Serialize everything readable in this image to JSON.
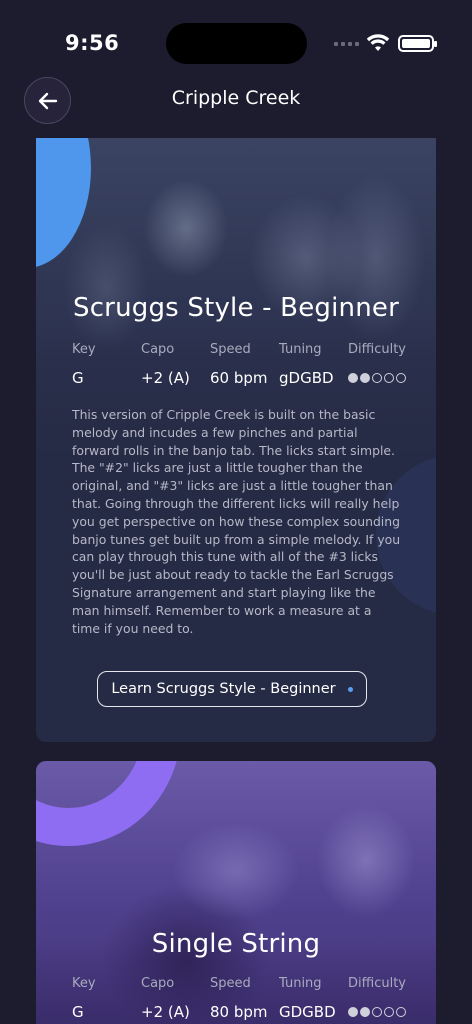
{
  "status_bar": {
    "time": "9:56"
  },
  "nav": {
    "title": "Cripple Creek",
    "back_icon": "arrow-left-icon"
  },
  "meta_labels": {
    "key": "Key",
    "capo": "Capo",
    "speed": "Speed",
    "tuning": "Tuning",
    "difficulty": "Difficulty"
  },
  "arrangements": [
    {
      "title": "Scruggs Style - Beginner",
      "key": "G",
      "capo": "+2 (A)",
      "speed": "60 bpm",
      "tuning": "gDGBD",
      "difficulty": 2,
      "difficulty_max": 5,
      "description": "This version of Cripple Creek is built on the basic melody and incudes a few pinches and partial forward rolls in the banjo tab. The licks start simple. The \"#2\" licks are just a little tougher than the original, and \"#3\" licks are just a little tougher than that. Going through the different licks will really help you get perspective on how these complex sounding banjo tunes get built up from a simple melody. If you can play through this tune with all of the #3 licks you'll be just about ready to tackle the Earl Scruggs Signature arrangement and start playing like the man himself. Remember to work a measure at a time if you need to.",
      "button_label": "Learn Scruggs Style - Beginner",
      "accent_color": "#4f97ec"
    },
    {
      "title": "Single String",
      "key": "G",
      "capo": "+2 (A)",
      "speed": "80 bpm",
      "tuning": "GDGBD",
      "difficulty": 2,
      "difficulty_max": 5,
      "accent_color": "#8f6df2"
    }
  ]
}
